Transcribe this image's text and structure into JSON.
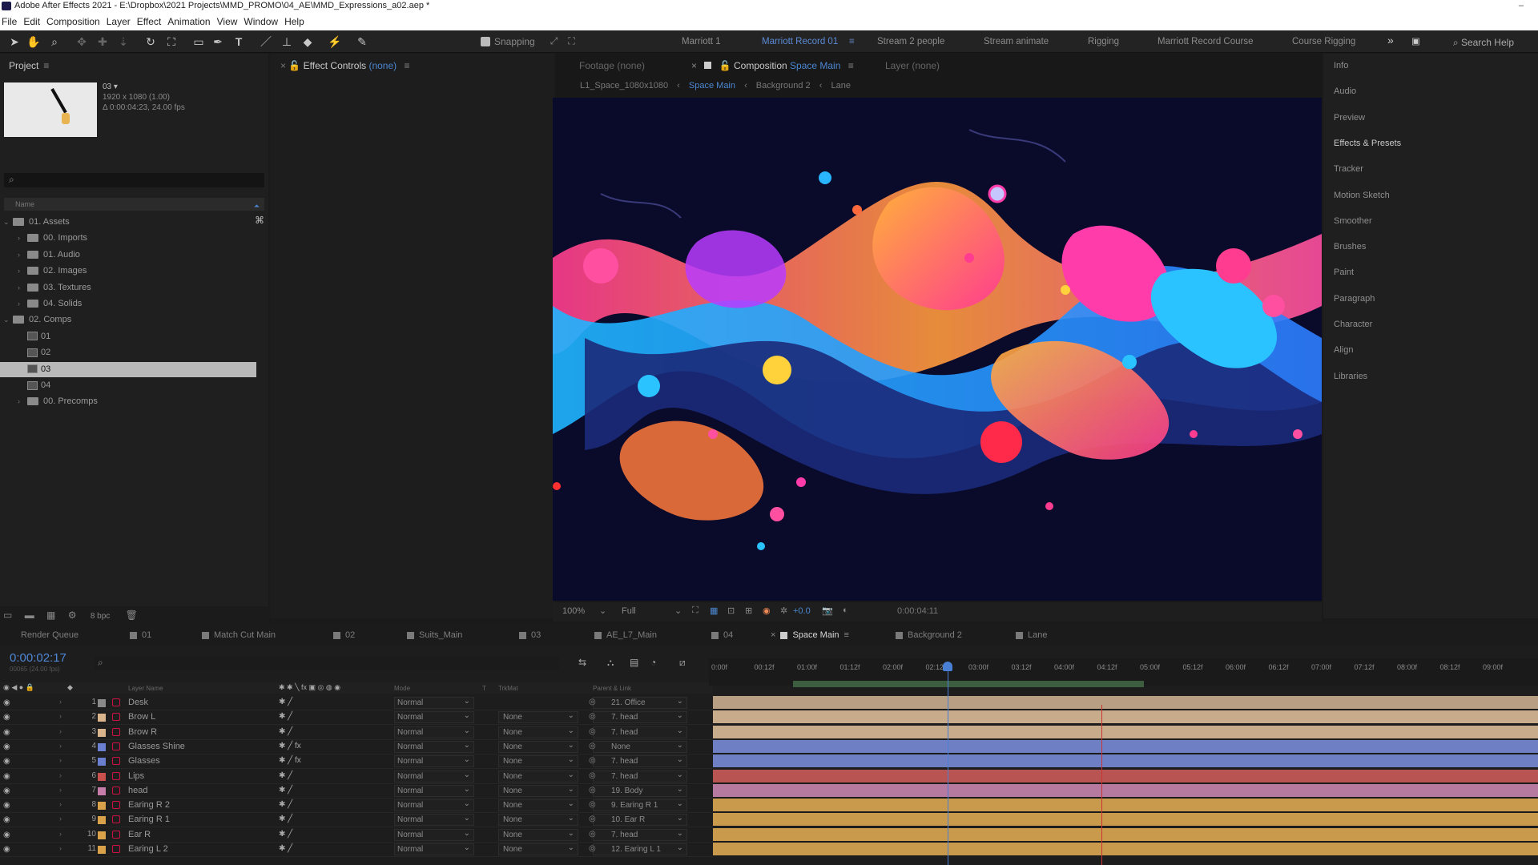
{
  "titlebar": {
    "title": "Adobe After Effects 2021 - E:\\Dropbox\\2021 Projects\\MMD_PROMO\\04_AE\\MMD_Expressions_a02.aep *",
    "close": "–"
  },
  "menu": [
    "File",
    "Edit",
    "Composition",
    "Layer",
    "Effect",
    "Animation",
    "View",
    "Window",
    "Help"
  ],
  "toolbar": {
    "snapping": "Snapping",
    "workspaces": [
      "Marriott 1",
      "Marriott Record 01",
      "Stream 2 people",
      "Stream animate",
      "Rigging",
      "Marriott Record Course",
      "Course Rigging"
    ],
    "active_workspace": "Marriott Record 01",
    "more": "»",
    "search_help": "Search Help"
  },
  "project": {
    "title": "Project",
    "thumb_name": "03 ▾",
    "thumb_info1": "1920 x 1080 (1.00)",
    "thumb_info2": "Δ 0:00:04:23, 24.00 fps",
    "column": "Name",
    "tree": [
      {
        "label": "01. Assets",
        "type": "folder",
        "indent": 0,
        "open": true
      },
      {
        "label": "00. Imports",
        "type": "folder",
        "indent": 1
      },
      {
        "label": "01. Audio",
        "type": "folder",
        "indent": 1
      },
      {
        "label": "02. Images",
        "type": "folder",
        "indent": 1
      },
      {
        "label": "03. Textures",
        "type": "folder",
        "indent": 1
      },
      {
        "label": "04. Solids",
        "type": "folder",
        "indent": 1
      },
      {
        "label": "02. Comps",
        "type": "folder",
        "indent": 0,
        "open": true
      },
      {
        "label": "01",
        "type": "comp",
        "indent": 1
      },
      {
        "label": "02",
        "type": "comp",
        "indent": 1
      },
      {
        "label": "03",
        "type": "comp",
        "indent": 1,
        "selected": true
      },
      {
        "label": "04",
        "type": "comp",
        "indent": 1
      },
      {
        "label": "00. Precomps",
        "type": "folder",
        "indent": 1
      }
    ],
    "footer_bpc": "8 bpc"
  },
  "effect_controls": {
    "title": "Effect Controls",
    "value": "(none)"
  },
  "comp_panel": {
    "footage": "Footage (none)",
    "composition_label": "Composition",
    "composition_name": "Space Main",
    "layer": "Layer (none)",
    "breadcrumb": [
      "L1_Space_1080x1080",
      "Space Main",
      "Background 2",
      "Lane"
    ],
    "zoom": "100%",
    "resolution": "Full",
    "exposure": "+0.0",
    "timecode": "0:00:04:11"
  },
  "right_panel": [
    "Info",
    "Audio",
    "Preview",
    "Effects & Presets",
    "Tracker",
    "Motion Sketch",
    "Smoother",
    "Brushes",
    "Paint",
    "Paragraph",
    "Character",
    "Align",
    "Libraries"
  ],
  "bottom_tabs": [
    {
      "label": "Render Queue"
    },
    {
      "label": "01"
    },
    {
      "label": "Match Cut Main"
    },
    {
      "label": "02"
    },
    {
      "label": "Suits_Main"
    },
    {
      "label": "03"
    },
    {
      "label": "AE_L7_Main"
    },
    {
      "label": "04"
    },
    {
      "label": "Space Main",
      "active": true
    },
    {
      "label": "Background 2"
    },
    {
      "label": "Lane"
    }
  ],
  "timeline": {
    "timecode": "0:00:02:17",
    "timecode_sub": "00065 (24.00 fps)",
    "headers": {
      "layer_name": "Layer Name",
      "mode": "Mode",
      "t": "T",
      "trkmat": "TrkMat",
      "parent": "Parent & Link"
    },
    "ruler": [
      "0:00f",
      "00:12f",
      "01:00f",
      "01:12f",
      "02:00f",
      "02:12f",
      "03:00f",
      "03:12f",
      "04:00f",
      "04:12f",
      "05:00f",
      "05:12f",
      "06:00f",
      "06:12f",
      "07:00f",
      "07:12f",
      "08:00f",
      "08:12f",
      "09:00f"
    ],
    "layers": [
      {
        "num": "1",
        "name": "Desk",
        "color": "#8a8a8a",
        "mode": "Normal",
        "trk": "",
        "parent": "21. Office",
        "bar": "#b89e82"
      },
      {
        "num": "2",
        "name": "Brow L",
        "color": "#d9b48c",
        "mode": "Normal",
        "trk": "None",
        "parent": "7. head",
        "bar": "#c7ab8a"
      },
      {
        "num": "3",
        "name": "Brow R",
        "color": "#d9b48c",
        "mode": "Normal",
        "trk": "None",
        "parent": "7. head",
        "bar": "#c7ab8a"
      },
      {
        "num": "4",
        "name": "Glasses Shine",
        "color": "#6b7fd0",
        "mode": "Normal",
        "trk": "None",
        "parent": "None",
        "bar": "#6f7fc4"
      },
      {
        "num": "5",
        "name": "Glasses",
        "color": "#6b7fd0",
        "mode": "Normal",
        "trk": "None",
        "parent": "7. head",
        "bar": "#6f7fc4"
      },
      {
        "num": "6",
        "name": "Lips",
        "color": "#c9504d",
        "mode": "Normal",
        "trk": "None",
        "parent": "7. head",
        "bar": "#b85452"
      },
      {
        "num": "7",
        "name": "head",
        "color": "#c77da9",
        "mode": "Normal",
        "trk": "None",
        "parent": "19. Body",
        "bar": "#b679a0"
      },
      {
        "num": "8",
        "name": "Earing R 2",
        "color": "#d9a14a",
        "mode": "Normal",
        "trk": "None",
        "parent": "9. Earing R 1",
        "bar": "#c99a4c"
      },
      {
        "num": "9",
        "name": "Earing R 1",
        "color": "#d9a14a",
        "mode": "Normal",
        "trk": "None",
        "parent": "10. Ear R",
        "bar": "#c99a4c"
      },
      {
        "num": "10",
        "name": "Ear R",
        "color": "#d9a14a",
        "mode": "Normal",
        "trk": "None",
        "parent": "7. head",
        "bar": "#c99a4c"
      },
      {
        "num": "11",
        "name": "Earing L 2",
        "color": "#d9a14a",
        "mode": "Normal",
        "trk": "None",
        "parent": "12. Earing L 1",
        "bar": "#c99a4c"
      }
    ]
  }
}
